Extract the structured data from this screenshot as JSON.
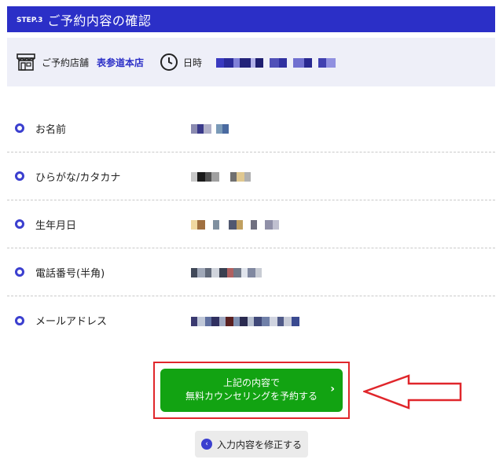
{
  "step": {
    "badge": "STEP.3",
    "title": "ご予約内容の確認"
  },
  "info": {
    "store_label": "ご予約店舗",
    "store_name": "表参道本店",
    "datetime_label": "日時",
    "datetime_value_masked": true
  },
  "fields": [
    {
      "label": "お名前"
    },
    {
      "label": "ひらがな/カタカナ"
    },
    {
      "label": "生年月日"
    },
    {
      "label": "電話番号(半角)"
    },
    {
      "label": "メールアドレス"
    }
  ],
  "confirm": {
    "line1": "上記の内容で",
    "line2": "無料カウンセリングを予約する",
    "chevron": "›"
  },
  "back": {
    "label": "入力内容を修正する",
    "icon": "‹"
  },
  "colors": {
    "header": "#2b2fc7",
    "accent": "#3b3fcf",
    "button_green": "#12a312",
    "highlight_red": "#e0262b"
  }
}
